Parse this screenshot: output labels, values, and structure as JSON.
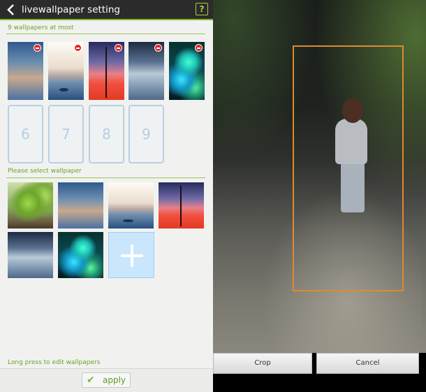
{
  "settings": {
    "title": "livewallpaper setting",
    "help_label": "?",
    "selected_section_label": "9 wallpapers at most",
    "selected_wallpapers": [
      {
        "image": "blurred-clouds"
      },
      {
        "image": "calm-lake-dusk"
      },
      {
        "image": "plant-silhouette-sunset"
      },
      {
        "image": "foggy-sea"
      },
      {
        "image": "green-bokeh"
      }
    ],
    "empty_slots": [
      "6",
      "7",
      "8",
      "9"
    ],
    "select_section_label": "Please select wallpaper",
    "available_wallpapers": [
      {
        "image": "green-leaves"
      },
      {
        "image": "blurred-clouds"
      },
      {
        "image": "calm-lake-dusk"
      },
      {
        "image": "plant-silhouette-sunset"
      },
      {
        "image": "foggy-sea"
      },
      {
        "image": "green-bokeh"
      }
    ],
    "add_icon": "plus-icon",
    "hint": "Long press to edit wallpapers",
    "apply_label": "apply",
    "apply_icon": "checkmark-icon",
    "accent_color": "#7fb82a"
  },
  "crop_view": {
    "photo": "woman-walking-forest-path",
    "crop_frame_color": "#e0892e",
    "crop_label": "Crop",
    "cancel_label": "Cancel"
  }
}
